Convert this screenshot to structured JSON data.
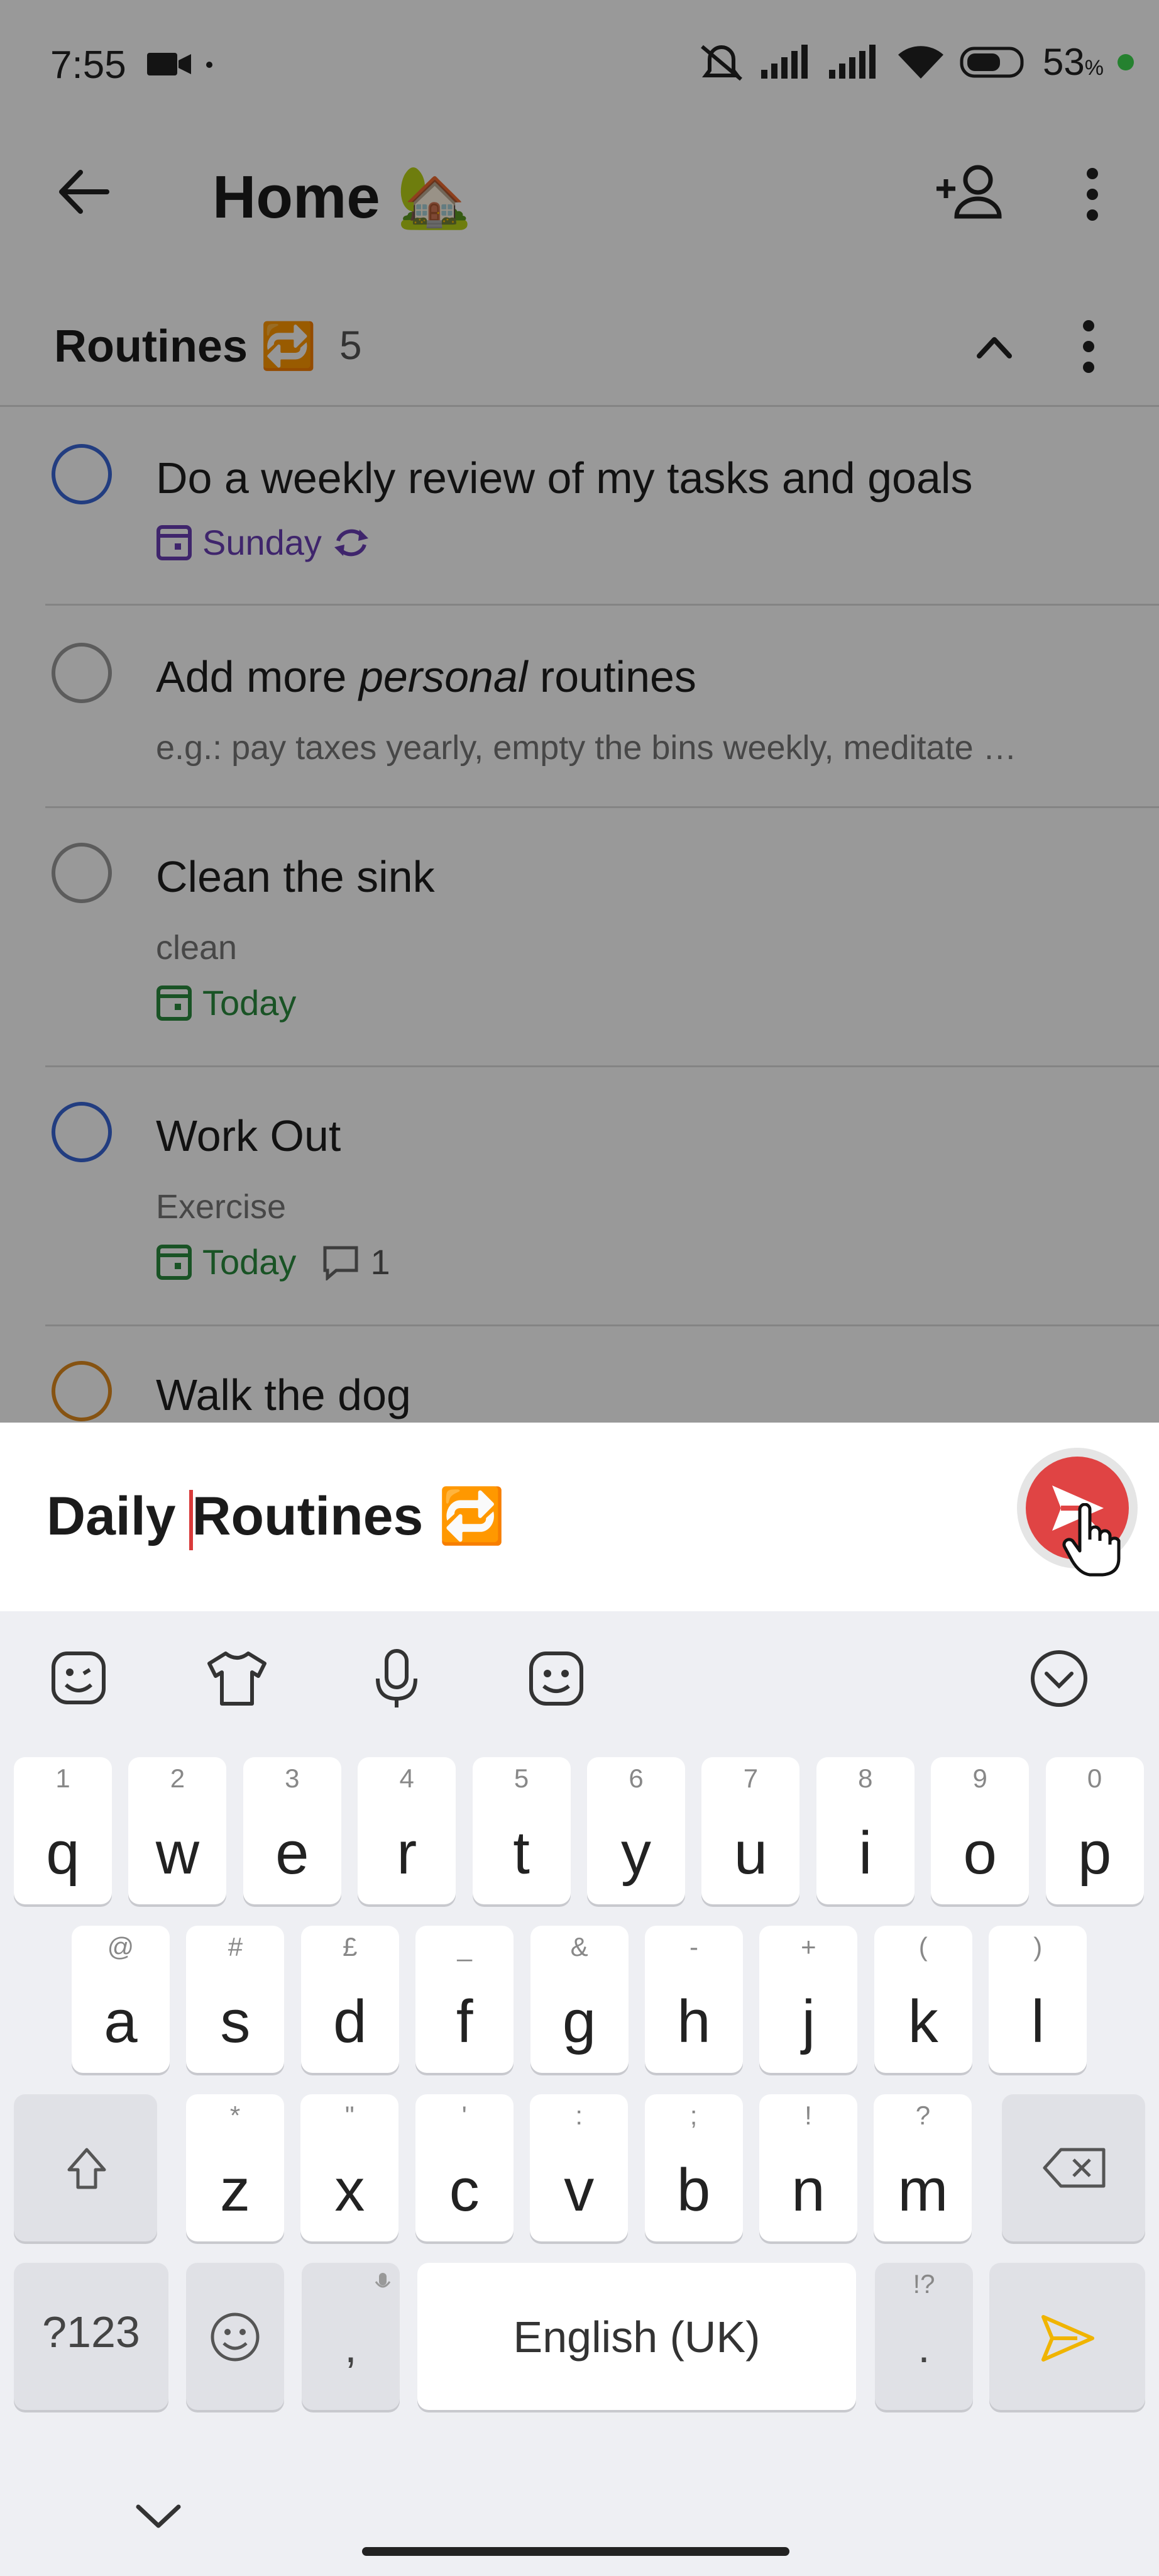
{
  "status_bar": {
    "time": "7:55",
    "battery": "53",
    "battery_unit": "%",
    "icons": [
      "video-camera-icon",
      "dot-icon",
      "mute-icon",
      "signal-icon",
      "signal-icon",
      "wifi-icon",
      "battery-icon"
    ]
  },
  "header": {
    "title": "Home",
    "title_emoji": "🏡",
    "back_icon": "arrow-left-icon",
    "share_icon": "add-person-icon",
    "more_icon": "more-vertical-icon"
  },
  "section": {
    "title": "Routines",
    "title_emoji": "🔁",
    "count": "5",
    "collapse_icon": "chevron-up-icon",
    "more_icon": "more-vertical-icon"
  },
  "tasks": [
    {
      "title": "Do a weekly review of my tasks and goals",
      "date": "Sunday",
      "date_color": "#6a3fb5",
      "circle_color": "#3a66d6",
      "recurring": true
    },
    {
      "title_before": "Add more ",
      "title_italic": "personal",
      "title_after": " routines",
      "description": "e.g.: pay taxes yearly, empty the bins weekly, meditate …",
      "circle_color": "#9a9a9a"
    },
    {
      "title": "Clean the sink",
      "description": "clean",
      "date": "Today",
      "date_color": "#2b8a3e",
      "circle_color": "#9a9a9a"
    },
    {
      "title": "Work Out",
      "description": "Exercise",
      "date": "Today",
      "date_color": "#2b8a3e",
      "comments": "1",
      "circle_color": "#3a66d6"
    },
    {
      "title": "Walk the dog",
      "circle_color": "#e08a1e"
    }
  ],
  "composer": {
    "text_before_cursor": "Daily ",
    "text_after_cursor": "Routines",
    "emoji": "🔁",
    "send_icon": "send-icon",
    "accent": "#e04444"
  },
  "keyboard": {
    "toolbar_icons": [
      "emoji-sticker-icon",
      "theme-shirt-icon",
      "microphone-icon",
      "sticker-face-icon",
      "collapse-keyboard-icon"
    ],
    "row1": [
      {
        "key": "q",
        "hint": "1"
      },
      {
        "key": "w",
        "hint": "2"
      },
      {
        "key": "e",
        "hint": "3"
      },
      {
        "key": "r",
        "hint": "4"
      },
      {
        "key": "t",
        "hint": "5"
      },
      {
        "key": "y",
        "hint": "6"
      },
      {
        "key": "u",
        "hint": "7"
      },
      {
        "key": "i",
        "hint": "8"
      },
      {
        "key": "o",
        "hint": "9"
      },
      {
        "key": "p",
        "hint": "0"
      }
    ],
    "row2": [
      {
        "key": "a",
        "hint": "@"
      },
      {
        "key": "s",
        "hint": "#"
      },
      {
        "key": "d",
        "hint": "£"
      },
      {
        "key": "f",
        "hint": "_"
      },
      {
        "key": "g",
        "hint": "&"
      },
      {
        "key": "h",
        "hint": "-"
      },
      {
        "key": "j",
        "hint": "+"
      },
      {
        "key": "k",
        "hint": "("
      },
      {
        "key": "l",
        "hint": ")"
      }
    ],
    "row3": [
      {
        "key": "z",
        "hint": "*"
      },
      {
        "key": "x",
        "hint": "\""
      },
      {
        "key": "c",
        "hint": "'"
      },
      {
        "key": "v",
        "hint": ":"
      },
      {
        "key": "b",
        "hint": ";"
      },
      {
        "key": "n",
        "hint": "!"
      },
      {
        "key": "m",
        "hint": "?"
      }
    ],
    "symbols_label": "?123",
    "comma": ",",
    "space_label": "English (UK)",
    "period": ".",
    "period_hint": "!?",
    "enter_color": "#f0b400"
  }
}
